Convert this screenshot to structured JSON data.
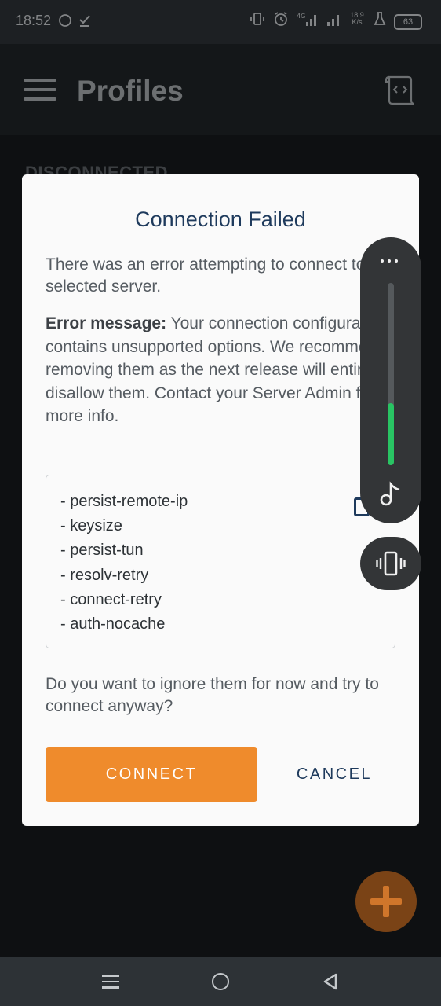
{
  "status_bar": {
    "time": "18:52",
    "battery": "63",
    "network_speed": "18.9\nK/s",
    "left_icons": [
      "circle-notification-icon",
      "download-done-icon"
    ],
    "right_icons": [
      "vibrate-icon",
      "alarm-icon",
      "signal-4g-icon",
      "signal-icon",
      "network-speed-icon",
      "flask-icon",
      "battery-icon"
    ]
  },
  "app_bar": {
    "title": "Profiles",
    "menu_icon": "menu-icon",
    "import_icon": "import-profile-icon"
  },
  "background": {
    "section_label": "DISCONNECTED"
  },
  "dialog": {
    "title": "Connection Failed",
    "intro": "There was an error attempting to connect to the selected server.",
    "error_label": "Error message:",
    "error_text": " Your connection configuration contains unsupported options. We recommend removing them as the next release will entirely disallow them. Contact your Server Admin for more info.",
    "options": [
      "- persist-remote-ip",
      "- keysize",
      "- persist-tun",
      "- resolv-retry",
      "- connect-retry",
      "- auth-nocache"
    ],
    "question": "Do you want to ignore them for now and try to connect anyway?",
    "connect_label": "CONNECT",
    "cancel_label": "CANCEL"
  },
  "volume_panel": {
    "level": 0.34,
    "more_icon": "more-horizontal-icon",
    "music_icon": "music-note-icon",
    "vibrate_icon": "vibrate-icon"
  },
  "fab": {
    "icon": "plus-icon"
  },
  "colors": {
    "accent": "#ef8b2c",
    "title_navy": "#1e3a5c",
    "volume_green": "#29c463"
  }
}
